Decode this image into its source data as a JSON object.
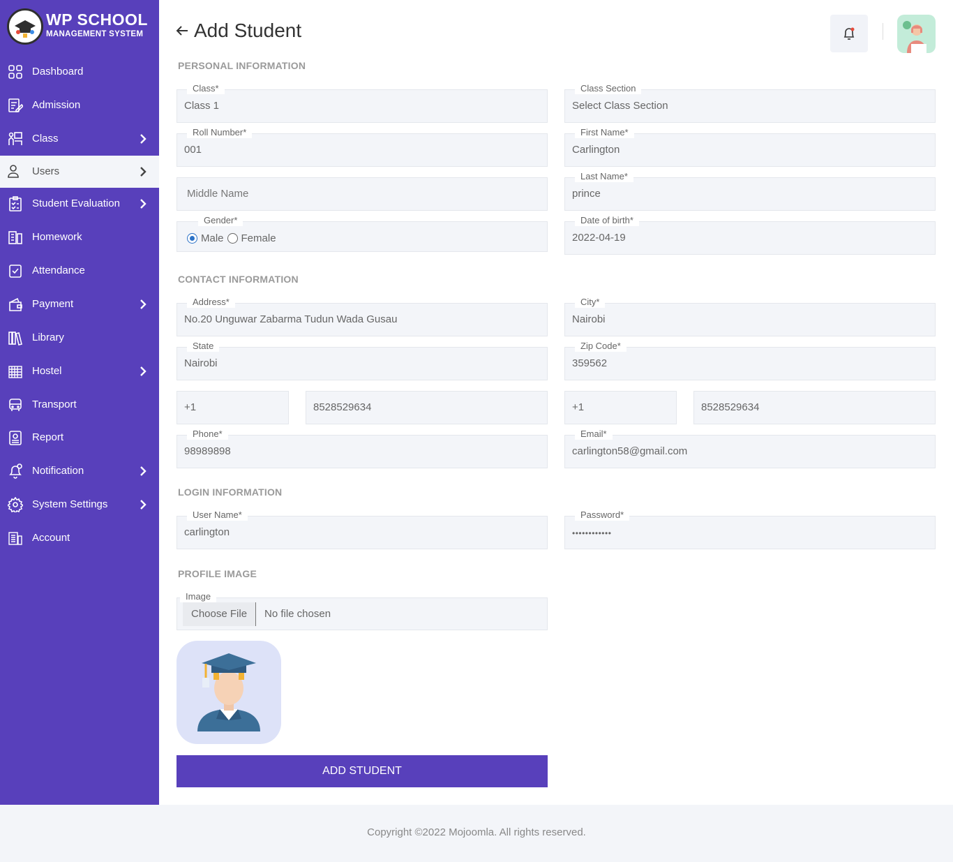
{
  "app": {
    "logo_title": "WP SCHOOL",
    "logo_subtitle": "MANAGEMENT SYSTEM"
  },
  "sidebar": {
    "items": [
      {
        "label": "Dashboard",
        "icon": "dashboard-icon",
        "has_submenu": false
      },
      {
        "label": "Admission",
        "icon": "admission-icon",
        "has_submenu": false
      },
      {
        "label": "Class",
        "icon": "class-icon",
        "has_submenu": true
      },
      {
        "label": "Users",
        "icon": "user-icon",
        "has_submenu": true,
        "active": true
      },
      {
        "label": "Student Evaluation",
        "icon": "evaluation-icon",
        "has_submenu": true
      },
      {
        "label": "Homework",
        "icon": "homework-icon",
        "has_submenu": false
      },
      {
        "label": "Attendance",
        "icon": "attendance-icon",
        "has_submenu": false
      },
      {
        "label": "Payment",
        "icon": "wallet-icon",
        "has_submenu": true
      },
      {
        "label": "Library",
        "icon": "library-icon",
        "has_submenu": false
      },
      {
        "label": "Hostel",
        "icon": "hostel-icon",
        "has_submenu": true
      },
      {
        "label": "Transport",
        "icon": "bus-icon",
        "has_submenu": false
      },
      {
        "label": "Report",
        "icon": "report-icon",
        "has_submenu": false
      },
      {
        "label": "Notification",
        "icon": "notification-icon",
        "has_submenu": true
      },
      {
        "label": "System Settings",
        "icon": "gear-icon",
        "has_submenu": true
      },
      {
        "label": "Account",
        "icon": "account-icon",
        "has_submenu": false
      }
    ]
  },
  "header": {
    "title": "Add Student"
  },
  "sections": {
    "personal": "PERSONAL INFORMATION",
    "contact": "CONTACT INFORMATION",
    "login": "LOGIN INFORMATION",
    "profile": "PROFILE IMAGE"
  },
  "form": {
    "class": {
      "label": "Class*",
      "value": "Class 1"
    },
    "class_section": {
      "label": "Class Section",
      "value": "Select Class Section"
    },
    "roll_number": {
      "label": "Roll Number*",
      "value": "001"
    },
    "first_name": {
      "label": "First Name*",
      "value": "Carlington"
    },
    "middle_name": {
      "placeholder": "Middle Name"
    },
    "last_name": {
      "label": "Last Name*",
      "value": "prince"
    },
    "gender": {
      "label": "Gender*",
      "options": [
        "Male",
        "Female"
      ],
      "selected": "Male"
    },
    "dob": {
      "label": "Date of birth*",
      "value": "2022-04-19"
    },
    "address": {
      "label": "Address*",
      "value": "No.20 Unguwar Zabarma Tudun Wada Gusau"
    },
    "city": {
      "label": "City*",
      "value": "Nairobi"
    },
    "state": {
      "label": "State",
      "value": "Nairobi"
    },
    "zip": {
      "label": "Zip Code*",
      "value": "359562"
    },
    "mobile_code_1": "+1",
    "mobile_number_1": "8528529634",
    "mobile_code_2": "+1",
    "mobile_number_2": "8528529634",
    "phone": {
      "label": "Phone*",
      "value": "98989898"
    },
    "email": {
      "label": "Email*",
      "value": "carlington58@gmail.com"
    },
    "username": {
      "label": "User Name*",
      "value": "carlington"
    },
    "password": {
      "label": "Password*",
      "value": "••••••••••••"
    },
    "image": {
      "label": "Image",
      "button": "Choose File",
      "status": "No file chosen"
    },
    "submit_label": "ADD STUDENT"
  },
  "footer": {
    "copyright": "Copyright ©2022 Mojoomla. All rights reserved."
  }
}
